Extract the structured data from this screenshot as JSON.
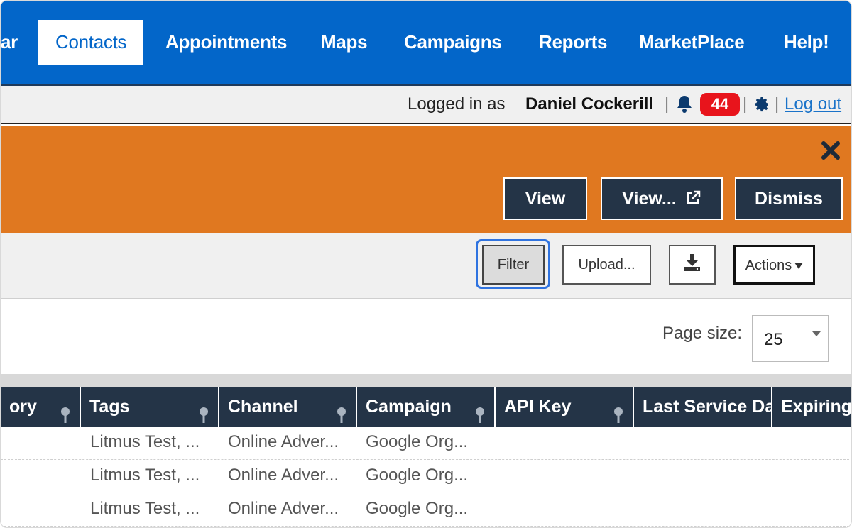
{
  "nav": {
    "items": [
      "ar",
      "Contacts",
      "Appointments",
      "Maps",
      "Campaigns",
      "Reports",
      "MarketPlace",
      "Help!"
    ]
  },
  "userbar": {
    "logged_in_prefix": "Logged in as",
    "user_name": "Daniel Cockerill",
    "notification_count": "44",
    "logout": "Log out",
    "separator": "|"
  },
  "banner": {
    "view_label": "View",
    "view_external_label": "View...",
    "dismiss_label": "Dismiss"
  },
  "toolbar": {
    "filter_label": "Filter",
    "upload_label": "Upload...",
    "actions_label": "Actions"
  },
  "pagesize": {
    "label": "Page size:",
    "value": "25"
  },
  "grid": {
    "columns": [
      "ory",
      "Tags",
      "Channel",
      "Campaign",
      "API Key",
      "Last Service Da",
      "Expiring"
    ],
    "rows": [
      [
        "Litmus Test, ...",
        "Online Adver...",
        "Google Org..."
      ],
      [
        "Litmus Test, ...",
        "Online Adver...",
        "Google Org..."
      ],
      [
        "Litmus Test, ...",
        "Online Adver...",
        "Google Org..."
      ]
    ]
  },
  "colors": {
    "nav_blue": "#0366c9",
    "banner_orange": "#e07820",
    "dark_navy": "#243447",
    "badge_red": "#e8141c",
    "focus_blue": "#2f73e0"
  }
}
